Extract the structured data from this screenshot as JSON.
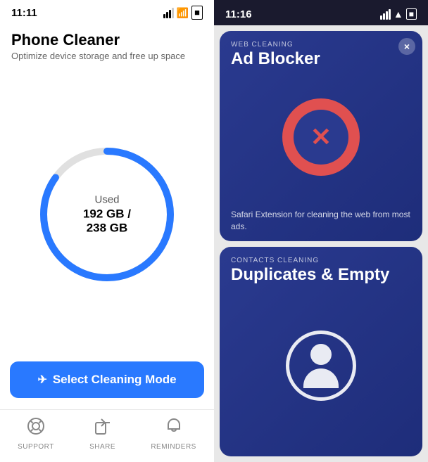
{
  "left": {
    "status": {
      "time": "11:11",
      "signal": "●●●",
      "wifi": "wifi",
      "battery": "battery"
    },
    "header": {
      "title": "Phone Cleaner",
      "subtitle": "Optimize device storage and free up space"
    },
    "storage": {
      "used_label": "Used",
      "used": "192 GB",
      "total": "238 GB",
      "used_display": "192 GB / 238 GB",
      "progress_percent": 80
    },
    "button": {
      "label": "Select Cleaning Mode",
      "icon": "✈"
    },
    "nav": [
      {
        "id": "support",
        "label": "SUPPORT",
        "icon": "🆘"
      },
      {
        "id": "share",
        "label": "SHARE",
        "icon": "↗"
      },
      {
        "id": "reminders",
        "label": "REMINDERS",
        "icon": "🔔"
      }
    ]
  },
  "right": {
    "status": {
      "time": "11:16"
    },
    "cards": [
      {
        "id": "ad-blocker",
        "category": "WEB CLEANING",
        "title": "Ad Blocker",
        "description": "Safari Extension for cleaning the web from most ads.",
        "icon_type": "ad-blocker"
      },
      {
        "id": "duplicates",
        "category": "CONTACTS CLEANING",
        "title": "Duplicates & Empty",
        "description": "",
        "icon_type": "contact"
      }
    ],
    "close_label": "×"
  },
  "colors": {
    "accent_blue": "#2979ff",
    "card_dark_blue": "#1e2d7a",
    "ad_red": "#e05050"
  }
}
